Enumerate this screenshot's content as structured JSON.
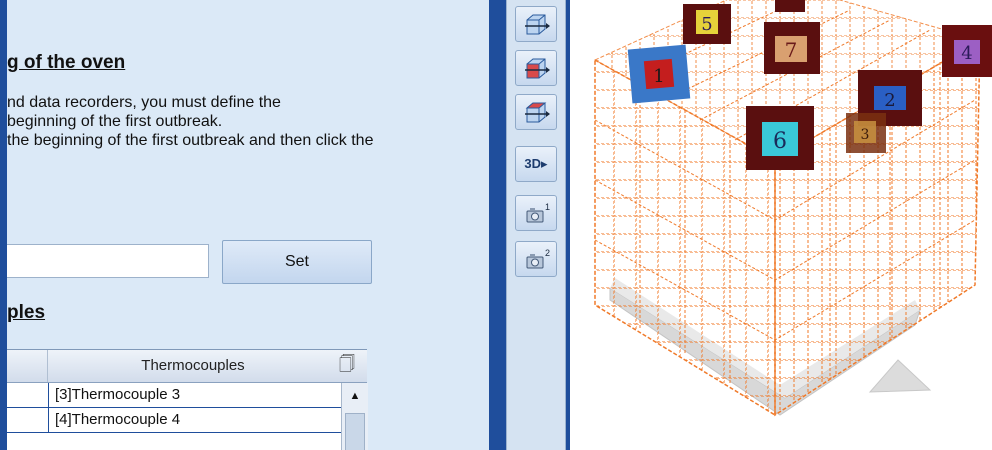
{
  "section1": {
    "title": "g of the oven"
  },
  "description": {
    "lines": [
      "nd data recorders, you must define the",
      "beginning of the first outbreak.",
      "the beginning of the first outbreak and then click the"
    ]
  },
  "time_input": {
    "value": ""
  },
  "set_button": {
    "label": "Set"
  },
  "section2": {
    "title": "ples"
  },
  "grid": {
    "header": "Thermocouples",
    "rows": [
      "[3]Thermocouple 3",
      "[4]Thermocouple 4"
    ]
  },
  "toolbar": {
    "buttons": [
      {
        "name": "view-front-button",
        "icon": "cube-front-icon"
      },
      {
        "name": "view-side-button",
        "icon": "cube-side-icon"
      },
      {
        "name": "view-top-button",
        "icon": "cube-top-icon"
      },
      {
        "name": "view-3d-button",
        "icon": "3d-view-icon",
        "label": "3D"
      },
      {
        "name": "camera-1-button",
        "icon": "camera-1-icon",
        "label": "1"
      },
      {
        "name": "camera-2-button",
        "icon": "camera-2-icon",
        "label": "2"
      }
    ]
  },
  "viewport": {
    "labels": [
      {
        "text": "5",
        "bg": "#5a0f0f",
        "fg": "#e6d23a"
      },
      {
        "text": "7",
        "bg": "#5a0f0f",
        "fg": "#d9a070"
      },
      {
        "text": "4",
        "bg": "#6a0f0f",
        "fg": "#9c5fc4"
      },
      {
        "text": "1",
        "bg": "#3a78c8",
        "fg": "#c41e1e"
      },
      {
        "text": "2",
        "bg": "#5a0f0f",
        "fg": "#2a5fc4"
      },
      {
        "text": "6",
        "bg": "#5a0f0f",
        "fg": "#3ac8d8"
      },
      {
        "text": "3",
        "bg": "#7a3010",
        "fg": "#c89040"
      }
    ],
    "colors": {
      "mesh": "#f07a2a",
      "base": "#d8d8d8"
    }
  }
}
